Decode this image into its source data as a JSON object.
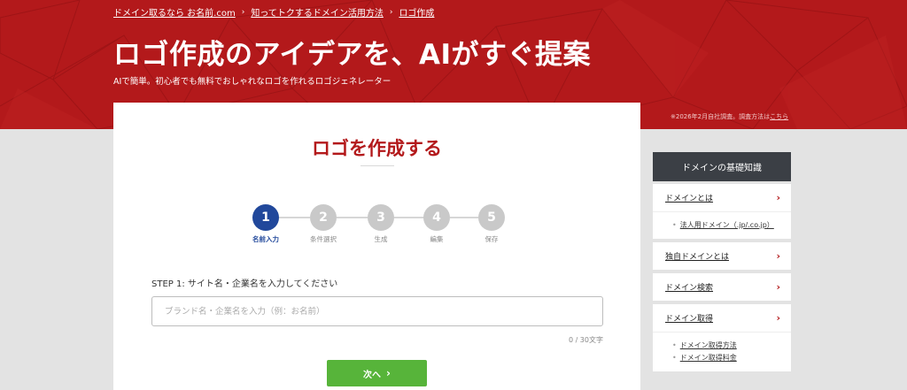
{
  "breadcrumb": {
    "items": [
      "ドメイン取るなら お名前.com",
      "知ってトクするドメイン活用方法",
      "ロゴ作成"
    ],
    "separator": "›"
  },
  "hero": {
    "title": "ロゴ作成のアイデアを、AIがすぐ提案",
    "subtitle": "AIで簡単。初心者でも無料でおしゃれなロゴを作れるロゴジェネレーター",
    "note_prefix": "※2026年2月自社調査。調査方法は",
    "note_link": "こちら",
    "bg_color": "#b3191b"
  },
  "card": {
    "title": "ロゴを作成する",
    "steps": [
      {
        "num": "1",
        "label": "名前入力",
        "active": true
      },
      {
        "num": "2",
        "label": "条件選択",
        "active": false
      },
      {
        "num": "3",
        "label": "生成",
        "active": false
      },
      {
        "num": "4",
        "label": "編集",
        "active": false
      },
      {
        "num": "5",
        "label": "保存",
        "active": false
      }
    ],
    "field_label": "STEP 1: サイト名・企業名を入力してください",
    "input_value": "",
    "input_placeholder": "ブランド名・企業名を入力（例：お名前）",
    "char_count": "0 / 30文字",
    "next_label": "次へ",
    "next_icon": "chevron-right-icon",
    "accent_color": "#21489b",
    "button_color": "#57b43a"
  },
  "sidebar": {
    "heading": "ドメインの基礎知識",
    "items": [
      {
        "label": "ドメインとは",
        "subs": [
          "法人用ドメイン（.jp/.co.jp）"
        ]
      },
      {
        "label": "独自ドメインとは",
        "subs": []
      },
      {
        "label": "ドメイン検索",
        "subs": []
      },
      {
        "label": "ドメイン取得",
        "subs": [
          "ドメイン取得方法",
          "ドメイン取得料金"
        ]
      }
    ]
  }
}
